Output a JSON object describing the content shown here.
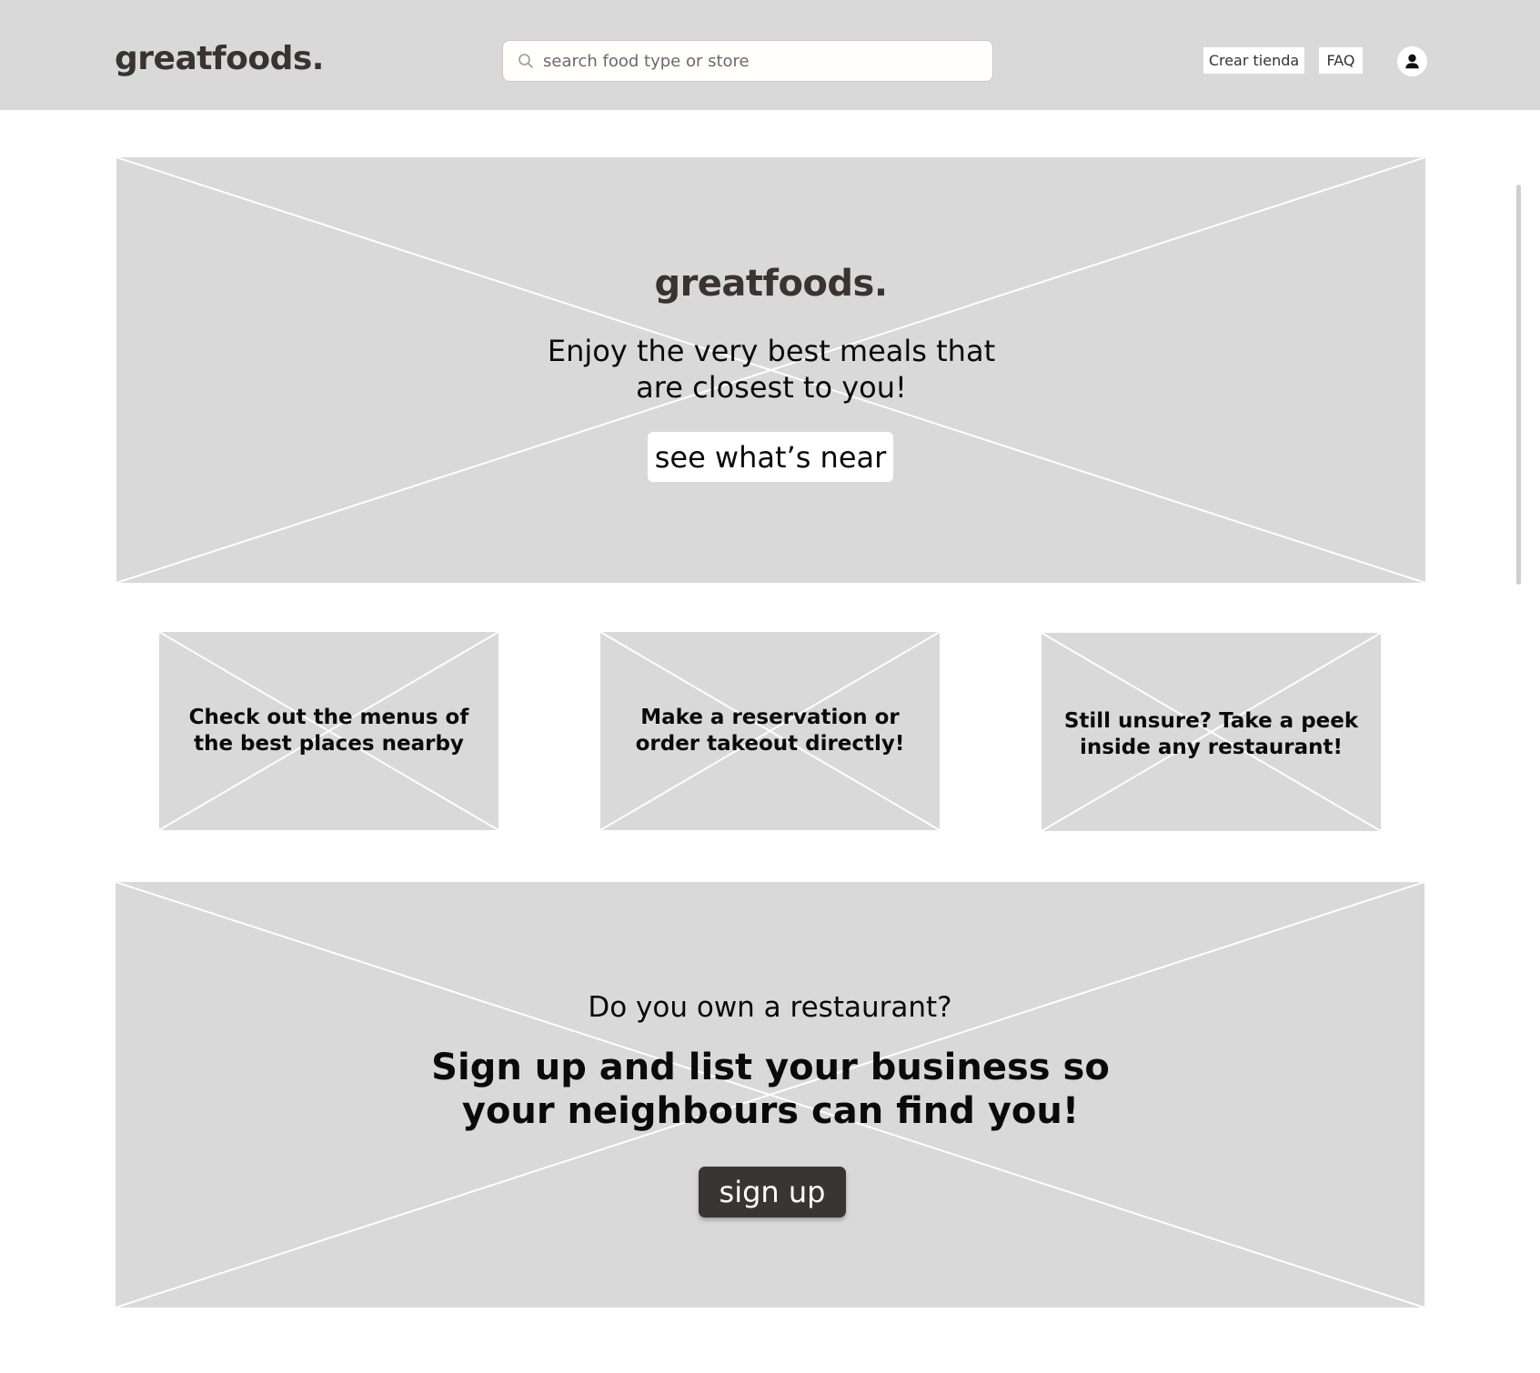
{
  "header": {
    "logo": "greatfoods.",
    "search": {
      "placeholder": "search food type or store",
      "value": ""
    },
    "crear_label": "Crear tienda",
    "faq_label": "FAQ"
  },
  "hero": {
    "logo": "greatfoods.",
    "tagline": "Enjoy the very best meals that are closest to you!",
    "button_label": "see what’s near"
  },
  "features": [
    {
      "text": "Check out the menus of the best places nearby"
    },
    {
      "text": "Make a reservation or order takeout directly!"
    },
    {
      "text": "Still unsure? Take a peek inside any restaurant!"
    }
  ],
  "owner_cta": {
    "question": "Do you own a restaurant?",
    "headline": "Sign up and list your business so your neighbours can find you!",
    "button_label": "sign up"
  },
  "icons": {
    "search": "search-icon",
    "account": "user-icon"
  },
  "colors": {
    "header_bg": "#d9d9d9",
    "placeholder_bg": "#d9d9d9",
    "logo_text": "#3a3333",
    "signup_button": "#3a3535"
  }
}
